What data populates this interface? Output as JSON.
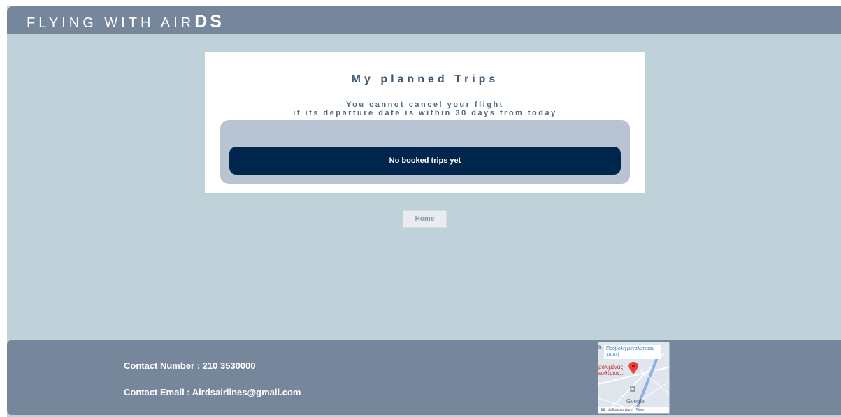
{
  "header": {
    "brand_prefix": "FLYING WITH AIR",
    "brand_suffix": "DS"
  },
  "trips": {
    "title": "My planned Trips",
    "note_line1": "You cannot cancel your flight",
    "note_line2": "if its departure date is within 30 days from today",
    "empty_message": "No booked trips yet"
  },
  "nav": {
    "home_label": "Home"
  },
  "footer": {
    "contact_number": "Contact Number : 210 3530000",
    "contact_email": "Contact Email : Airdsairlines@gmail.com"
  },
  "map": {
    "corner_text": "Ις",
    "view_larger_link": "Προβολή μεγαλύτερου χάρτη",
    "place_line1": "ρολιμένας",
    "place_line2": "ευθέριος...",
    "logo": "Google",
    "attribution": "Δεδομένα χάρτη",
    "terms": "Όροι",
    "marker_color": "#ea4335"
  },
  "colors": {
    "background": "#c0d2d9",
    "header": "#77879b",
    "empty_bar": "#00264d",
    "trips_panel": "#b9c4d2"
  }
}
